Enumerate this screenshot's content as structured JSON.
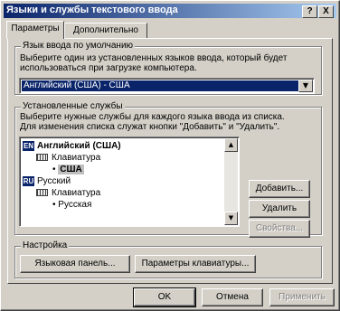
{
  "window": {
    "title": "Языки и службы текстового ввода",
    "help_label": "?",
    "close_label": "X"
  },
  "tabs": [
    {
      "label": "Параметры",
      "active": true
    },
    {
      "label": "Дополнительно",
      "active": false
    }
  ],
  "default_language": {
    "group_label": "Язык ввода по умолчанию",
    "description_line1": "Выберите один из установленных языков ввода, который будет",
    "description_line2": "использоваться при загрузке компьютера.",
    "selected_value": "Английский (США) - США"
  },
  "installed_services": {
    "group_label": "Установленные службы",
    "description_line1": "Выберите нужные службы для каждого языка ввода из списка.",
    "description_line2": "Для изменения списка служат кнопки \"Добавить\" и \"Удалить\".",
    "languages": [
      {
        "code": "EN",
        "name": "Английский (США)",
        "category": "Клавиатура",
        "layout": "США",
        "selected": true
      },
      {
        "code": "RU",
        "name": "Русский",
        "category": "Клавиатура",
        "layout": "Русская",
        "selected": false
      }
    ],
    "add_label": "Добавить...",
    "remove_label": "Удалить",
    "properties_label": "Свойства..."
  },
  "settings": {
    "group_label": "Настройка",
    "language_bar_label": "Языковая панель...",
    "key_settings_label": "Параметры клавиатуры..."
  },
  "footer": {
    "ok_label": "OK",
    "cancel_label": "Отмена",
    "apply_label": "Применить"
  },
  "colors": {
    "titlebar_start": "#0a246a",
    "titlebar_end": "#a6caf0",
    "face": "#d4d0c8",
    "selection": "#0a246a"
  }
}
